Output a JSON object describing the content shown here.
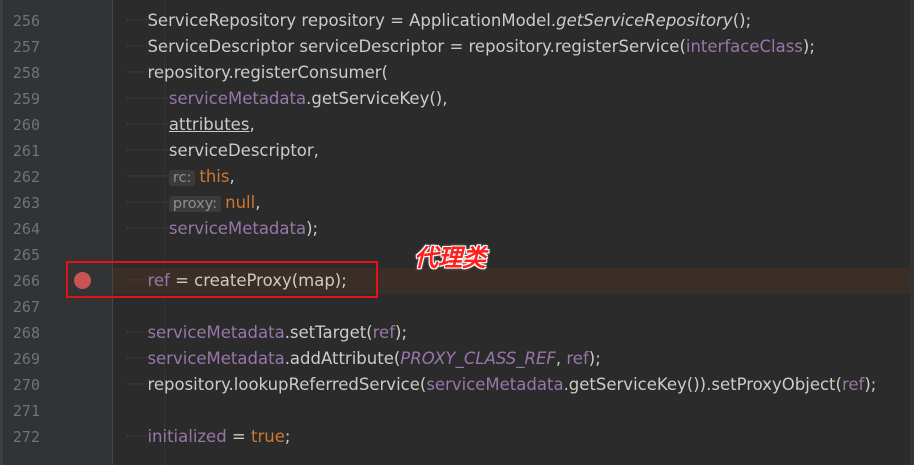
{
  "annotation": {
    "text": "代理类",
    "color": "#ff1f1f"
  },
  "colors": {
    "background": "#2b2b2b",
    "gutter": "#313335",
    "current_line": "#3a2e26",
    "breakpoint": "#c75450",
    "highlight_box": "#e5121a"
  },
  "breakpoint_line": "266",
  "lines": {
    "l256": {
      "num": "256",
      "t1": "ServiceRepository repository = ApplicationModel.",
      "t2": "getServiceRepository",
      "t3": "();"
    },
    "l257": {
      "num": "257",
      "t1": "ServiceDescriptor serviceDescriptor = repository.registerService(",
      "t2": "interfaceClass",
      "t3": ");"
    },
    "l258": {
      "num": "258",
      "t1": "repository.registerConsumer("
    },
    "l259": {
      "num": "259",
      "t1": "serviceMetadata",
      "t2": ".getServiceKey(),"
    },
    "l260": {
      "num": "260",
      "t1": "attributes",
      "t2": ","
    },
    "l261": {
      "num": "261",
      "t1": "serviceDescriptor,"
    },
    "l262": {
      "num": "262",
      "hint": "rc:",
      "t1": "this",
      "t2": ","
    },
    "l263": {
      "num": "263",
      "hint": "proxy:",
      "t1": "null",
      "t2": ","
    },
    "l264": {
      "num": "264",
      "t1": "serviceMetadata",
      "t2": ");"
    },
    "l265": {
      "num": "265"
    },
    "l266": {
      "num": "266",
      "t1": "ref",
      "t2": " = createProxy(map);"
    },
    "l267": {
      "num": "267"
    },
    "l268": {
      "num": "268",
      "t1": "serviceMetadata",
      "t2": ".setTarget(",
      "t3": "ref",
      "t4": ");"
    },
    "l269": {
      "num": "269",
      "t1": "serviceMetadata",
      "t2": ".addAttribute(",
      "t3": "PROXY_CLASS_REF",
      "t4": ", ",
      "t5": "ref",
      "t6": ");"
    },
    "l270": {
      "num": "270",
      "t1": "repository.lookupReferredService(",
      "t2": "serviceMetadata",
      "t3": ".getServiceKey()).setProxyObject(",
      "t4": "ref",
      "t5": ");"
    },
    "l271": {
      "num": "271"
    },
    "l272": {
      "num": "272",
      "t1": "initialized",
      "t2": " = ",
      "t3": "true",
      "t4": ";"
    }
  }
}
